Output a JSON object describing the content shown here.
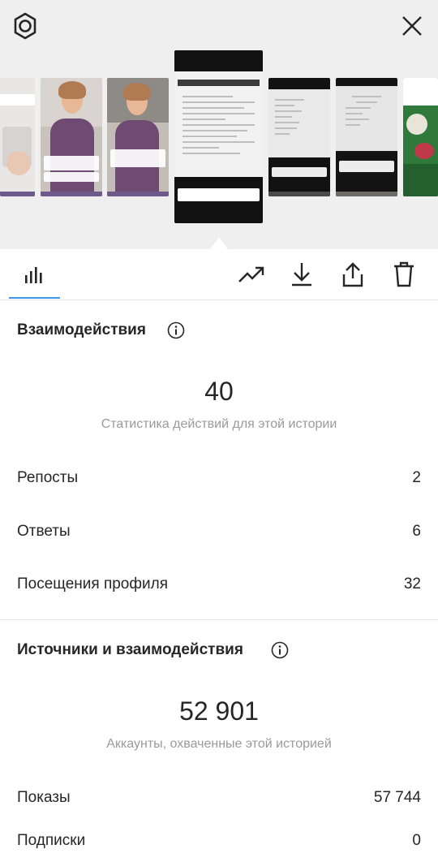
{
  "header": {
    "settings_icon": "gear-icon",
    "close_icon": "close-icon"
  },
  "thumbnails": [
    {
      "id": "story-1",
      "theme": "light-dashboard"
    },
    {
      "id": "story-2",
      "theme": "woman-kitchen"
    },
    {
      "id": "story-3",
      "theme": "woman-kitchen"
    },
    {
      "id": "story-4",
      "theme": "document-selected"
    },
    {
      "id": "story-5",
      "theme": "document"
    },
    {
      "id": "story-6",
      "theme": "document"
    },
    {
      "id": "story-7",
      "theme": "green-flowers"
    }
  ],
  "toolbar": {
    "insights_icon": "bar-chart-icon",
    "promote_icon": "trending-up-icon",
    "download_icon": "download-icon",
    "share_icon": "share-icon",
    "delete_icon": "trash-icon",
    "accent_color": "#3897f0"
  },
  "interactions": {
    "title": "Взаимодействия",
    "total": "40",
    "caption": "Статистика действий для этой истории",
    "rows": [
      {
        "label": "Репосты",
        "value": "2"
      },
      {
        "label": "Ответы",
        "value": "6"
      },
      {
        "label": "Посещения профиля",
        "value": "32"
      }
    ]
  },
  "discovery": {
    "title": "Источники и взаимодействия",
    "total": "52 901",
    "caption": "Аккаунты, охваченные этой историей",
    "rows": [
      {
        "label": "Показы",
        "value": "57 744"
      },
      {
        "label": "Подписки",
        "value": "0"
      }
    ]
  }
}
